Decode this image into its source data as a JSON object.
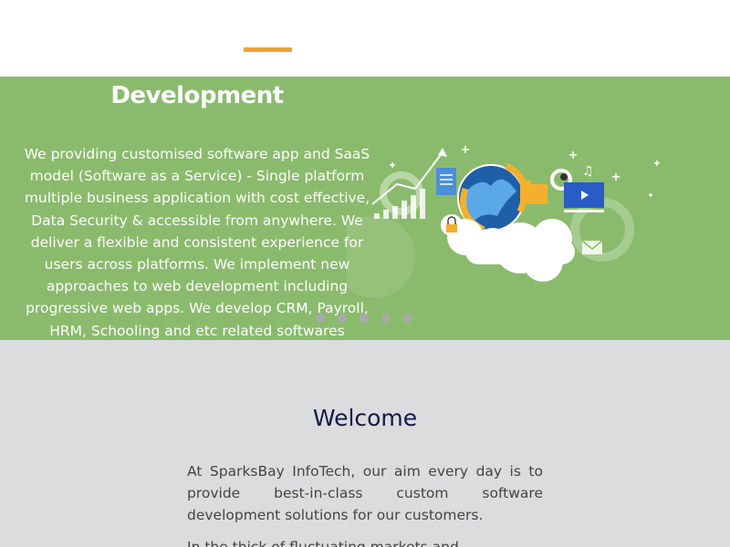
{
  "hero": {
    "title": "Development",
    "description": "We providing customised software app and SaaS model (Software as a Service) - Single platform multiple business application with cost effective, Data Security & accessible from anywhere. We deliver a flexible and consistent experience for users across platforms. We implement new approaches to web development including progressive web apps. We develop CRM, Payroll, HRM, Schooling and etc related softwares",
    "slide_count": 5,
    "illustration_icon": "cloud-software-illustration-icon"
  },
  "welcome": {
    "title": "Welcome",
    "paragraph1": "At SparksBay InfoTech, our aim every day is to provide best-in-class custom software development solutions for our customers.",
    "paragraph2": "In the thick of fluctuating markets and"
  },
  "colors": {
    "accent": "#f0a13a",
    "hero_bg": "#8abb6c",
    "page_bg": "#dcdcde",
    "title_navy": "#16164a"
  }
}
